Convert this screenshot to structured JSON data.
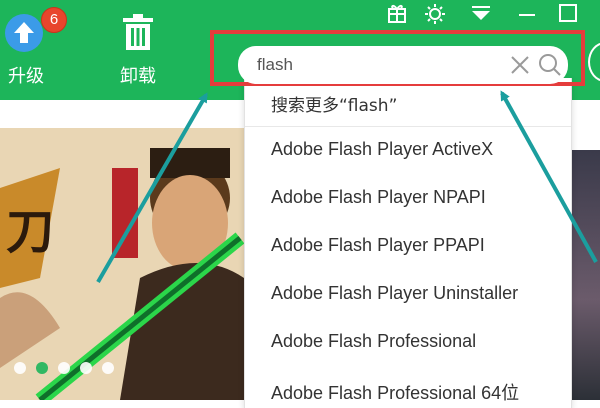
{
  "toolbar": {
    "upgrade": {
      "label": "升级",
      "badge": "6",
      "icon": "upload-arrow-icon"
    },
    "uninstall": {
      "label": "卸载",
      "icon": "trash-icon"
    }
  },
  "window_controls": {
    "icons": [
      "gift-icon",
      "settings-icon",
      "dropdown-menu-icon",
      "minimize-icon",
      "maximize-icon"
    ]
  },
  "search": {
    "value": "flash",
    "clear_icon": "close-icon",
    "search_icon": "search-icon"
  },
  "suggestions": {
    "search_more": "搜索更多“flash”",
    "items": [
      "Adobe Flash Player ActiveX",
      "Adobe Flash Player NPAPI",
      "Adobe Flash Player PPAPI",
      "Adobe Flash Player Uninstaller",
      "Adobe Flash Professional",
      "Adobe Flash Professional 64位"
    ]
  },
  "banner": {
    "slide_count": 5,
    "active_slide": 2
  },
  "colors": {
    "brand_green": "#1db55a",
    "highlight_red": "#e53c3c",
    "annotation_arrow": "#1b9e9e",
    "badge_red": "#e8452c"
  }
}
